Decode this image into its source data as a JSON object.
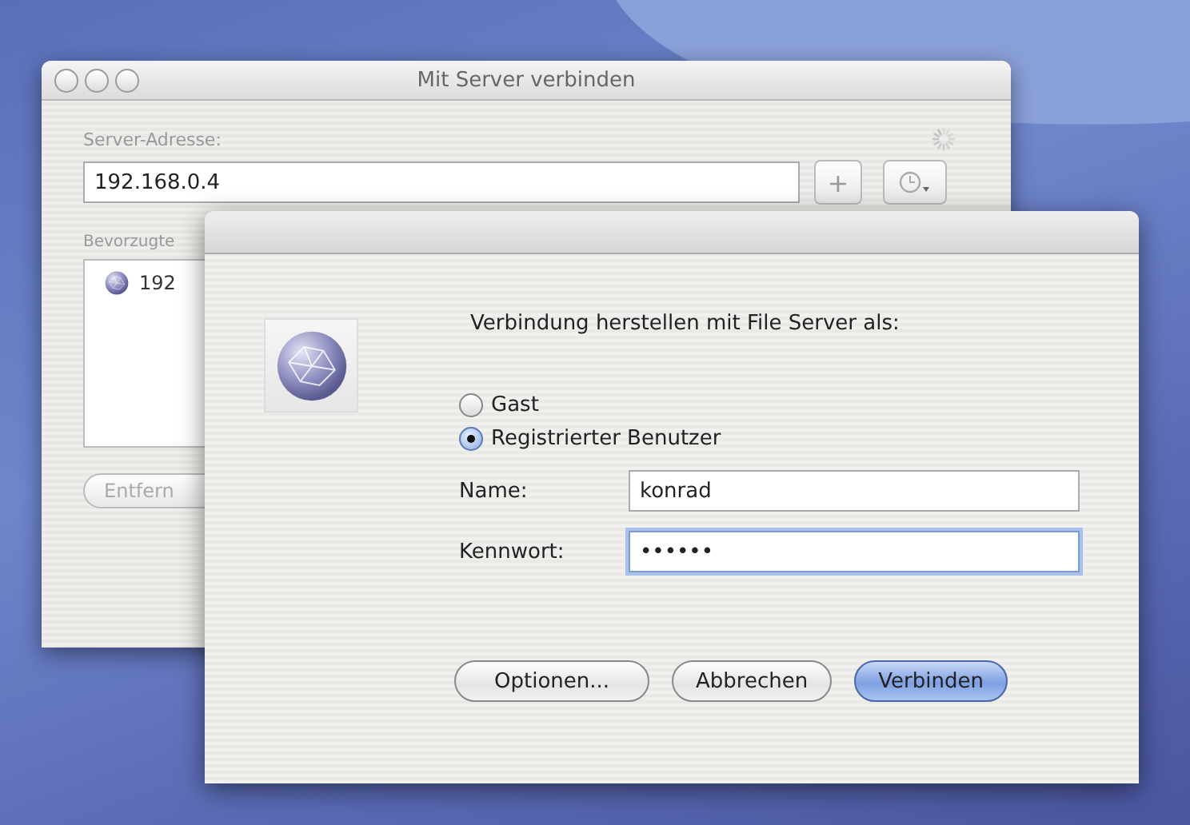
{
  "back_window": {
    "title": "Mit Server verbinden",
    "address_label": "Server-Adresse:",
    "address_value": "192.168.0.4",
    "add_button": "+",
    "favorites_label": "Bevorzugte",
    "favorites": [
      {
        "label": "192"
      }
    ],
    "remove_button": "Entfern"
  },
  "dialog": {
    "message": "Verbindung herstellen mit File Server als:",
    "options": [
      {
        "label": "Gast",
        "selected": false
      },
      {
        "label": "Registrierter Benutzer",
        "selected": true
      }
    ],
    "fields": [
      {
        "label": "Name:",
        "value": "konrad",
        "focused": false
      },
      {
        "label": "Kennwort:",
        "value": "••••••",
        "focused": true
      }
    ],
    "buttons": [
      {
        "label": "Optionen...",
        "default": false
      },
      {
        "label": "Abbrechen",
        "default": false
      },
      {
        "label": "Verbinden",
        "default": true
      }
    ]
  }
}
